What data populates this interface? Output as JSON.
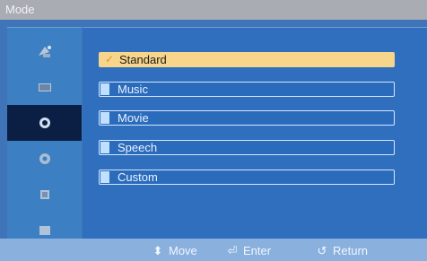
{
  "title": "Mode",
  "sidebar": {
    "items": [
      {
        "icon": "satellite-dish-icon",
        "active": false
      },
      {
        "icon": "screen-icon",
        "active": false
      },
      {
        "icon": "sound-icon",
        "active": true
      },
      {
        "icon": "setup-gear-icon",
        "active": false
      },
      {
        "icon": "input-source-icon",
        "active": false
      },
      {
        "icon": "picture-icon",
        "active": false
      }
    ]
  },
  "options": [
    {
      "label": "Standard",
      "selected": true
    },
    {
      "label": "Music",
      "selected": false
    },
    {
      "label": "Movie",
      "selected": false
    },
    {
      "label": "Speech",
      "selected": false
    },
    {
      "label": "Custom",
      "selected": false
    }
  ],
  "hints": {
    "move": "Move",
    "enter": "Enter",
    "return": "Return"
  },
  "colors": {
    "background_blue": "#3f74b8",
    "selected_highlight": "#f7d58a",
    "active_sidebar": "#0b1f44"
  }
}
